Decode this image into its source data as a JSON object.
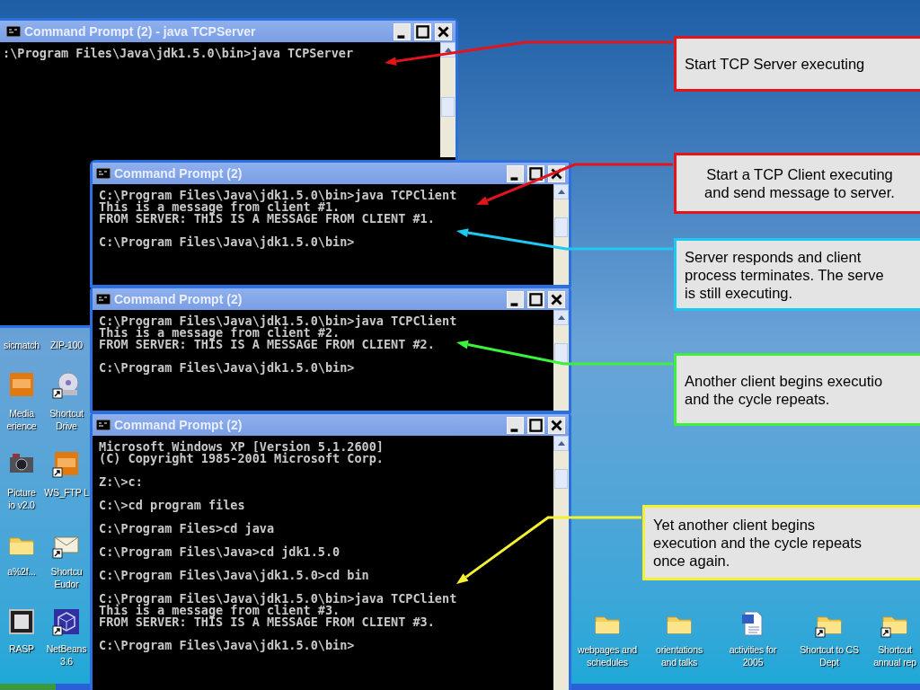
{
  "desktop_icons": [
    {
      "lines": [
        "sicmatch"
      ]
    },
    {
      "lines": [
        "ZIP-100"
      ]
    },
    {
      "kind": "tile",
      "shortcut": false,
      "lines": [
        "Media",
        "erience"
      ]
    },
    {
      "kind": "disc",
      "shortcut": true,
      "lines": [
        "Shortcut",
        "Drive"
      ]
    },
    {
      "kind": "camera",
      "shortcut": false,
      "lines": [
        "Picture",
        "io v2.0"
      ]
    },
    {
      "kind": "tile",
      "shortcut": true,
      "lines": [
        "WS_FTP L"
      ]
    },
    {
      "kind": "folder",
      "shortcut": false,
      "lines": [
        "a%2f..."
      ]
    },
    {
      "kind": "envelope",
      "shortcut": true,
      "lines": [
        "Shortcu",
        "Eudor"
      ]
    },
    {
      "kind": "framed",
      "shortcut": false,
      "lines": [
        "RASP"
      ]
    },
    {
      "kind": "cube",
      "shortcut": true,
      "lines": [
        "NetBeans",
        "3.6"
      ]
    },
    {
      "kind": "folder",
      "shortcut": false,
      "lines": [
        "webpages and",
        "schedules"
      ]
    },
    {
      "kind": "folder",
      "shortcut": false,
      "lines": [
        "orientations",
        "and talks"
      ]
    },
    {
      "kind": "document",
      "shortcut": false,
      "lines": [
        "activities for",
        "2005"
      ]
    },
    {
      "kind": "folder",
      "shortcut": true,
      "lines": [
        "Shortcut to CS",
        "Dept"
      ]
    },
    {
      "kind": "folder",
      "shortcut": true,
      "lines": [
        "Shortcut",
        "annual rep"
      ]
    }
  ],
  "windows": [
    {
      "title": "Command Prompt (2) - java TCPServer",
      "blocks": [
        [
          ":\\Program Files\\Java\\jdk1.5.0\\bin>java TCPServer"
        ]
      ]
    },
    {
      "title": "Command Prompt (2)",
      "blocks": [
        [
          "C:\\Program Files\\Java\\jdk1.5.0\\bin>java TCPClient",
          "This is a message from client #1.",
          "FROM SERVER: THIS IS A MESSAGE FROM CLIENT #1."
        ],
        [
          "C:\\Program Files\\Java\\jdk1.5.0\\bin>"
        ]
      ]
    },
    {
      "title": "Command Prompt (2)",
      "blocks": [
        [
          "C:\\Program Files\\Java\\jdk1.5.0\\bin>java TCPClient",
          "This is a message from client #2.",
          "FROM SERVER: THIS IS A MESSAGE FROM CLIENT #2."
        ],
        [
          "C:\\Program Files\\Java\\jdk1.5.0\\bin>"
        ]
      ]
    },
    {
      "title": "Command Prompt (2)",
      "blocks": [
        [
          "Microsoft Windows XP [Version 5.1.2600]",
          "(C) Copyright 1985-2001 Microsoft Corp."
        ],
        [
          "Z:\\>c:"
        ],
        [
          "C:\\>cd program files"
        ],
        [
          "C:\\Program Files>cd java"
        ],
        [
          "C:\\Program Files\\Java>cd jdk1.5.0"
        ],
        [
          "C:\\Program Files\\Java\\jdk1.5.0>cd bin"
        ],
        [
          "C:\\Program Files\\Java\\jdk1.5.0\\bin>java TCPClient",
          "This is a message from client #3.",
          "FROM SERVER: THIS IS A MESSAGE FROM CLIENT #3."
        ],
        [
          "C:\\Program Files\\Java\\jdk1.5.0\\bin>"
        ]
      ]
    }
  ],
  "callouts": [
    {
      "lines": [
        "Start TCP Server executing"
      ],
      "color": "#e3141b"
    },
    {
      "lines": [
        "Start a TCP Client executing",
        "and send message to server."
      ],
      "color": "#e3141b"
    },
    {
      "lines": [
        "Server responds and client",
        "process terminates.  The serve",
        "is still executing."
      ],
      "color": "#1ec8f0"
    },
    {
      "lines": [
        "Another client begins executio",
        "and the cycle repeats."
      ],
      "color": "#3cf03c"
    },
    {
      "lines": [
        "Yet another client begins",
        "execution and the cycle repeats",
        "once again."
      ],
      "color": "#f5f032"
    }
  ]
}
